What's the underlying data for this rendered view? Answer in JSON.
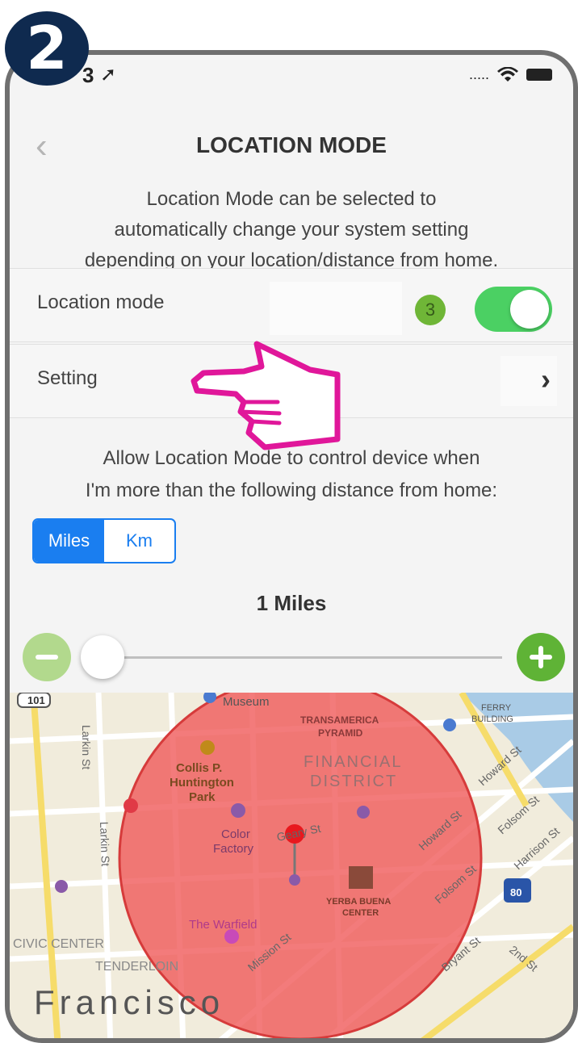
{
  "step_number": "2",
  "status_bar": {
    "time": "3",
    "carrier_dots": "....."
  },
  "nav": {
    "back_glyph": "‹",
    "title": "LOCATION MODE"
  },
  "description": {
    "line1": "Location Mode can be selected to",
    "line2": "automatically change your system setting",
    "line3": "depending on your location/distance from home."
  },
  "location_mode_row": {
    "label": "Location mode",
    "annotation_number": "3",
    "toggle_on": true
  },
  "setting_row": {
    "label": "Setting",
    "chevron": "›"
  },
  "allow_text": {
    "line1": "Allow Location Mode to control device when",
    "line2": "I'm more than the following distance from home:"
  },
  "units": {
    "selected": "Miles",
    "options": [
      "Miles",
      "Km"
    ]
  },
  "distance": {
    "value": 1,
    "label": "1 Miles"
  },
  "colors": {
    "accent": "#1a7ef0",
    "toggle_green": "#4bd063",
    "radius_fill": "#f05a5a",
    "hand": "#e0179a"
  },
  "map": {
    "labels": {
      "highway": "101",
      "larkin1": "Larkin St",
      "larkin2": "Larkin St",
      "museum": "Museum",
      "transamerica": "TRANSAMERICA",
      "pyramid": "PYRAMID",
      "ferry": "FERRY",
      "building": "BUILDING",
      "financial": "FINANCIAL",
      "district": "DISTRICT",
      "collis": "Collis P.",
      "huntington": "Huntington",
      "park": "Park",
      "color": "Color",
      "factory": "Factory",
      "geary": "Geary St",
      "howard": "Howard St",
      "howard2": "Howard St",
      "folsom": "Folsom St",
      "folsom2": "Folsom St",
      "harrison": "Harrison St",
      "yerba": "YERBA BUENA",
      "center": "CENTER",
      "warfield": "The Warfield",
      "interstate": "80",
      "civic": "CIVIC CENTER",
      "tenderloin": "TENDERLOIN",
      "mission": "Mission St",
      "bryant": "Bryant St",
      "second": "2nd St",
      "city": "Francisco"
    }
  }
}
